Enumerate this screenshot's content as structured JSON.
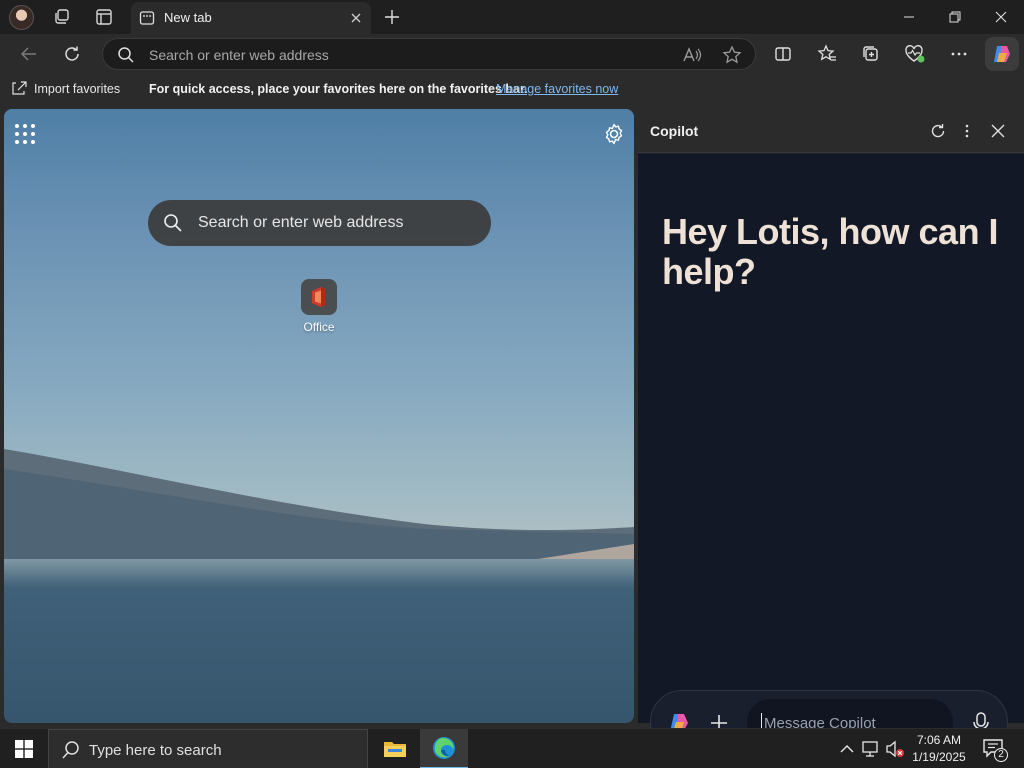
{
  "browser": {
    "tab": {
      "title": "New tab"
    },
    "address_bar": {
      "placeholder": "Search or enter web address"
    }
  },
  "favorites_bar": {
    "import_label": "Import favorites",
    "message": "For quick access, place your favorites here on the favorites bar.",
    "manage_link": "Manage favorites now"
  },
  "new_tab_page": {
    "search_placeholder": "Search or enter web address",
    "tiles": [
      {
        "label": "Office",
        "icon": "office-icon"
      }
    ]
  },
  "copilot": {
    "title": "Copilot",
    "greeting": "Hey Lotis, how can I help?",
    "message_placeholder": "Message Copilot"
  },
  "taskbar": {
    "search_placeholder": "Type here to search",
    "time": "7:06 AM",
    "date": "1/19/2025",
    "notification_count": "2"
  },
  "colors": {
    "link": "#7eb8f2",
    "greeting": "#eee2d6",
    "copilot_bg": "#131827",
    "active_indicator": "#76b9ed"
  }
}
